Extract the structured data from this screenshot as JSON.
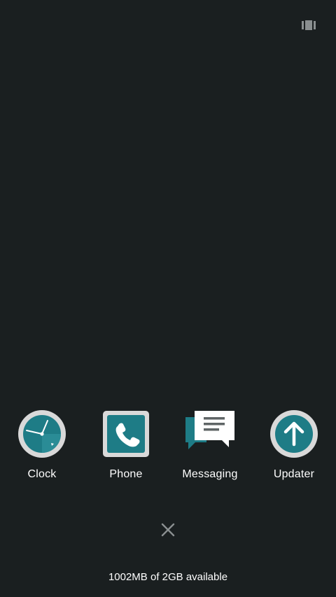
{
  "recents": {
    "layout_toggle_icon": "view-carousel-icon",
    "apps": [
      {
        "label": "Clock",
        "icon": "clock-icon"
      },
      {
        "label": "Phone",
        "icon": "phone-icon"
      },
      {
        "label": "Messaging",
        "icon": "messaging-icon"
      },
      {
        "label": "Updater",
        "icon": "upload-arrow-icon"
      }
    ],
    "close_all_icon": "close-icon",
    "memory_status": "1002MB of 2GB available"
  },
  "colors": {
    "background": "#1a1f20",
    "teal": "#1e7c86",
    "icon_ring": "#d9d9d9",
    "muted_icon": "#8a8f90"
  }
}
